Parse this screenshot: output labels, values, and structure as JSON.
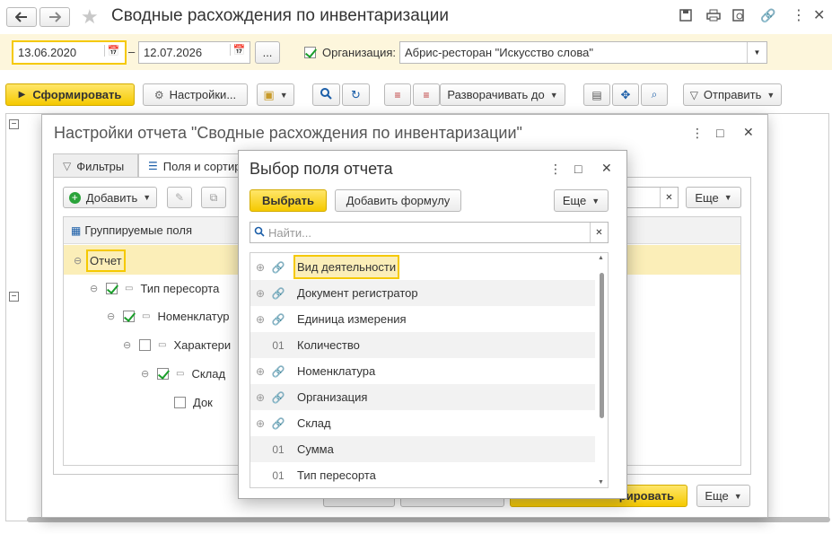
{
  "window": {
    "title": "Сводные расхождения по инвентаризации",
    "back_icon": "arrow-left-icon",
    "forward_icon": "arrow-right-icon"
  },
  "filters": {
    "date_from": "13.06.2020",
    "date_separator": "–",
    "date_to": "12.07.2026",
    "period_button": "...",
    "org_checked": true,
    "org_label": "Организация:",
    "org_value": "Абрис-ресторан \"Искусство слова\""
  },
  "toolbar": {
    "generate": "Сформировать",
    "settings": "Настройки...",
    "expand_to": "Разворачивать до",
    "send": "Отправить"
  },
  "settings_dialog": {
    "title": "Настройки отчета \"Сводные расхождения по инвентаризации\"",
    "tab_filters": "Фильтры",
    "tab_fields": "Поля и сортир",
    "add_button": "Добавить",
    "more_button": "Еще",
    "more_button_bottom": "Еще",
    "bottom_generate": "рировать",
    "grouped_header": "Группируемые поля",
    "tree": [
      {
        "label": "Отчет",
        "checked": null
      },
      {
        "label": "Тип пересорта",
        "checked": true
      },
      {
        "label": "Номенклатур",
        "checked": true
      },
      {
        "label": "Характери",
        "checked": false
      },
      {
        "label": "Склад",
        "checked": true
      },
      {
        "label": "Док",
        "checked": false
      }
    ]
  },
  "field_dialog": {
    "title": "Выбор поля отчета",
    "select_button": "Выбрать",
    "add_formula": "Добавить формулу",
    "more": "Еще",
    "search_placeholder": "Найти...",
    "items": [
      {
        "label": "Вид деятельности",
        "kind": "link"
      },
      {
        "label": "Документ регистратор",
        "kind": "link"
      },
      {
        "label": "Единица измерения",
        "kind": "link"
      },
      {
        "label": "Количество",
        "kind": "number",
        "prefix": "01"
      },
      {
        "label": "Номенклатура",
        "kind": "link"
      },
      {
        "label": "Организация",
        "kind": "link"
      },
      {
        "label": "Склад",
        "kind": "link"
      },
      {
        "label": "Сумма",
        "kind": "number",
        "prefix": "01"
      },
      {
        "label": "Тип пересорта",
        "kind": "number",
        "prefix": "01"
      }
    ]
  },
  "colors": {
    "accent_yellow": "#f5c900",
    "filter_bar_bg": "#fdf6dc",
    "selection_bg": "#fbeeb8",
    "checkmark": "#1a9e2a"
  }
}
